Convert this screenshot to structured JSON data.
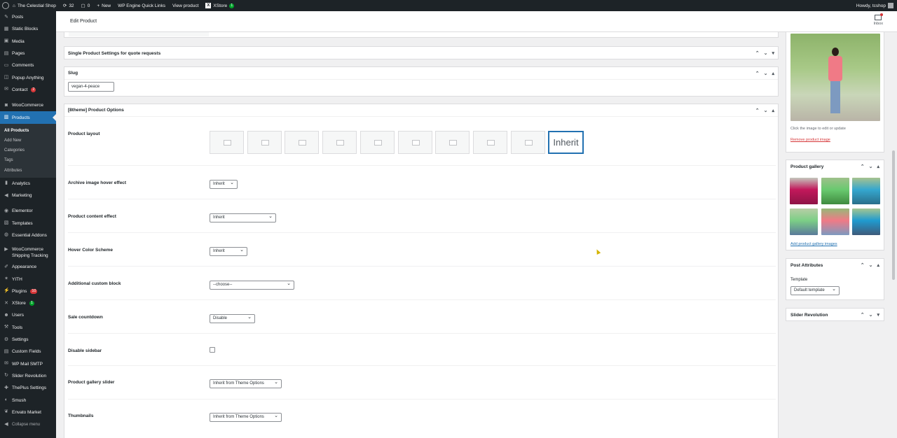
{
  "adminbar": {
    "site_name": "The Celestial Shop",
    "updates_count": "32",
    "comments_count": "0",
    "new_label": "New",
    "quick_links": "WP Engine Quick Links",
    "view_product": "View product",
    "xstore_label": "XStore",
    "xstore_badge": "1",
    "howdy": "Howdy, tcshop"
  },
  "sidebar": {
    "items": [
      {
        "label": "Posts",
        "icon": "pin-icon"
      },
      {
        "label": "Static Blocks",
        "icon": "blocks-icon"
      },
      {
        "label": "Media",
        "icon": "media-icon"
      },
      {
        "label": "Pages",
        "icon": "pages-icon"
      },
      {
        "label": "Comments",
        "icon": "comments-icon"
      },
      {
        "label": "Popup Anything",
        "icon": "popup-icon"
      },
      {
        "label": "Contact",
        "icon": "mail-icon",
        "badge": "2"
      },
      {
        "label": "WooCommerce",
        "icon": "woo-icon"
      },
      {
        "label": "Products",
        "icon": "products-icon"
      },
      {
        "label": "Analytics",
        "icon": "chart-icon"
      },
      {
        "label": "Marketing",
        "icon": "megaphone-icon"
      },
      {
        "label": "Elementor",
        "icon": "elementor-icon"
      },
      {
        "label": "Templates",
        "icon": "templates-icon"
      },
      {
        "label": "Essential Addons",
        "icon": "addons-icon"
      },
      {
        "label": "WooCommerce Shipping Tracking",
        "icon": "shipping-icon"
      },
      {
        "label": "Appearance",
        "icon": "brush-icon"
      },
      {
        "label": "YITH",
        "icon": "yith-icon"
      },
      {
        "label": "Plugins",
        "icon": "plugin-icon",
        "badge": "10"
      },
      {
        "label": "XStore",
        "icon": "xstore-icon",
        "badge": "1"
      },
      {
        "label": "Users",
        "icon": "users-icon"
      },
      {
        "label": "Tools",
        "icon": "tools-icon"
      },
      {
        "label": "Settings",
        "icon": "settings-icon"
      },
      {
        "label": "Custom Fields",
        "icon": "fields-icon"
      },
      {
        "label": "WP Mail SMTP",
        "icon": "smtp-icon"
      },
      {
        "label": "Slider Revolution",
        "icon": "slider-icon"
      },
      {
        "label": "ThePlus Settings",
        "icon": "plus-icon"
      },
      {
        "label": "Smush",
        "icon": "smush-icon"
      },
      {
        "label": "Envato Market",
        "icon": "envato-icon"
      },
      {
        "label": "Collapse menu",
        "icon": "collapse-icon"
      }
    ],
    "products_submenu": [
      "All Products",
      "Add New",
      "Categories",
      "Tags",
      "Attributes"
    ]
  },
  "header": {
    "title": "Edit Product",
    "inbox": "Inbox"
  },
  "panels": {
    "quote": {
      "title": "Single Product Settings for quote requests"
    },
    "slug": {
      "title": "Slug",
      "value": "vegan-4-peace"
    },
    "options": {
      "title": "[8theme] Product Options",
      "layout_label": "Product layout",
      "layout_selected": "Inherit",
      "fields": [
        {
          "label": "Archive image hover effect",
          "type": "select",
          "value": "Inherit"
        },
        {
          "label": "Product content effect",
          "type": "select",
          "value": "Inherit"
        },
        {
          "label": "Hover Color Scheme",
          "type": "select",
          "value": "Inherit"
        },
        {
          "label": "Additional custom block",
          "type": "select",
          "value": "--choose--"
        },
        {
          "label": "Sale countdown",
          "type": "select",
          "value": "Disable"
        },
        {
          "label": "Disable sidebar",
          "type": "checkbox",
          "value": ""
        },
        {
          "label": "Product gallery slider",
          "type": "select",
          "value": "Inherit from Theme Options"
        },
        {
          "label": "Thumbnails",
          "type": "select",
          "value": "Inherit from Theme Options"
        }
      ]
    }
  },
  "right": {
    "image_hint": "Click the image to edit or update",
    "remove_image": "Remove product image",
    "gallery_title": "Product gallery",
    "add_gallery": "Add product gallery images",
    "attributes_title": "Post Attributes",
    "template_label": "Template",
    "template_value": "Default template",
    "slider_title": "Slider Revolution"
  },
  "colors": {
    "accent": "#2271b1",
    "admin_dark": "#1d2327",
    "notice_red": "#d63638",
    "badge_green": "#00a32a"
  }
}
